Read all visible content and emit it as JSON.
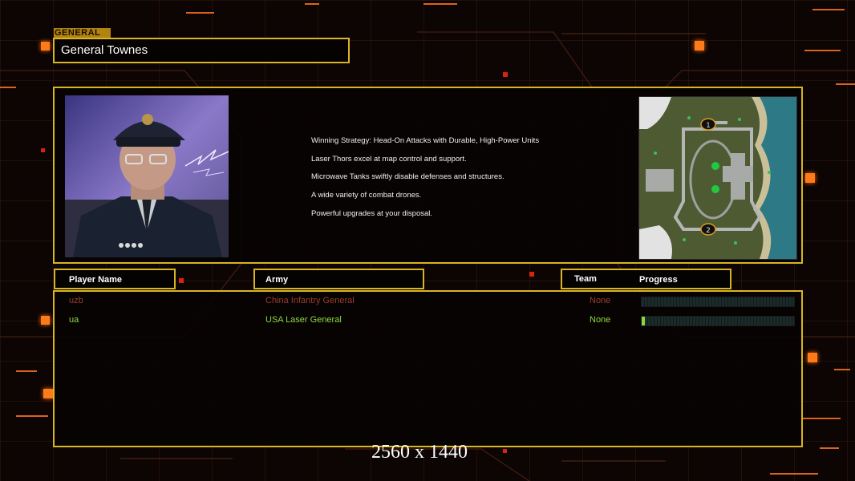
{
  "general": {
    "section_label": "GENERAL",
    "name": "General Townes"
  },
  "strategy": {
    "lines": [
      "Winning Strategy: Head-On Attacks with Durable, High-Power Units",
      "Laser Thors excel at map control and support.",
      "Microwave Tanks swiftly disable defenses and structures.",
      "A wide variety of combat drones.",
      "Powerful upgrades at your disposal."
    ]
  },
  "minimap": {
    "start_positions": [
      "1",
      "2"
    ]
  },
  "table": {
    "headers": {
      "player_name": "Player Name",
      "army": "Army",
      "team": "Team",
      "progress": "Progress"
    },
    "rows": [
      {
        "player": "uzb",
        "army": "China Infantry General",
        "team": "None",
        "progress": 0.0,
        "color": "#9a3d2f"
      },
      {
        "player": "ua",
        "army": "USA Laser General",
        "team": "None",
        "progress": 0.02,
        "color": "#8ddb3e"
      }
    ]
  },
  "overlay": {
    "resolution": "2560 x 1440"
  },
  "colors": {
    "frame_gold": "#d9b521",
    "accent_orange": "#ff7a18",
    "background": "#0c0504"
  }
}
